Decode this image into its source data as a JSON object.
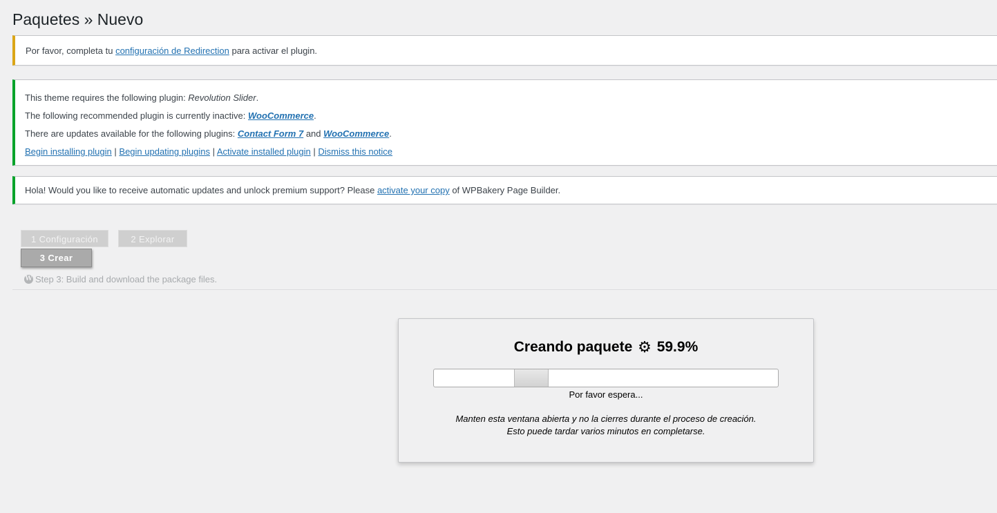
{
  "page": {
    "title": "Paquetes » Nuevo"
  },
  "notices": {
    "redirection": {
      "prefix": "Por favor, completa tu ",
      "link": "configuración de Redirection",
      "suffix": " para activar el plugin."
    },
    "tgmpa": {
      "line1_prefix": "This theme requires the following plugin: ",
      "line1_plugin": "Revolution Slider",
      "line1_suffix": ".",
      "line2_prefix": "The following recommended plugin is currently inactive: ",
      "line2_plugin": "WooCommerce",
      "line2_suffix": ".",
      "line3_prefix": "There are updates available for the following plugins: ",
      "line3_plugin1": "Contact Form 7",
      "line3_and": " and ",
      "line3_plugin2": "WooCommerce",
      "line3_suffix": ".",
      "links": {
        "begin_installing": "Begin installing plugin",
        "begin_updating": "Begin updating plugins",
        "activate_installed": "Activate installed plugin",
        "dismiss": "Dismiss this notice",
        "separator": "|"
      }
    },
    "wpbakery": {
      "prefix": "Hola! Would you like to receive automatic updates and unlock premium support? Please ",
      "link": "activate your copy",
      "suffix": " of WPBakery Page Builder."
    }
  },
  "steps": {
    "step1": "1 Configuración",
    "step2": "2 Explorar",
    "step3": "3 Crear",
    "description": "Step 3: Build and download the package files.",
    "description_icon": "wordpress-icon"
  },
  "build": {
    "title": "Creando paquete",
    "icon": "gear-icon",
    "percent": "59.9%",
    "progress_position": 0.26,
    "status": "Por favor espera...",
    "note_line1": "Manten esta ventana abierta y no la cierres durante el proceso de creación.",
    "note_line2": "Esto puede tardar varios minutos en completarse."
  }
}
